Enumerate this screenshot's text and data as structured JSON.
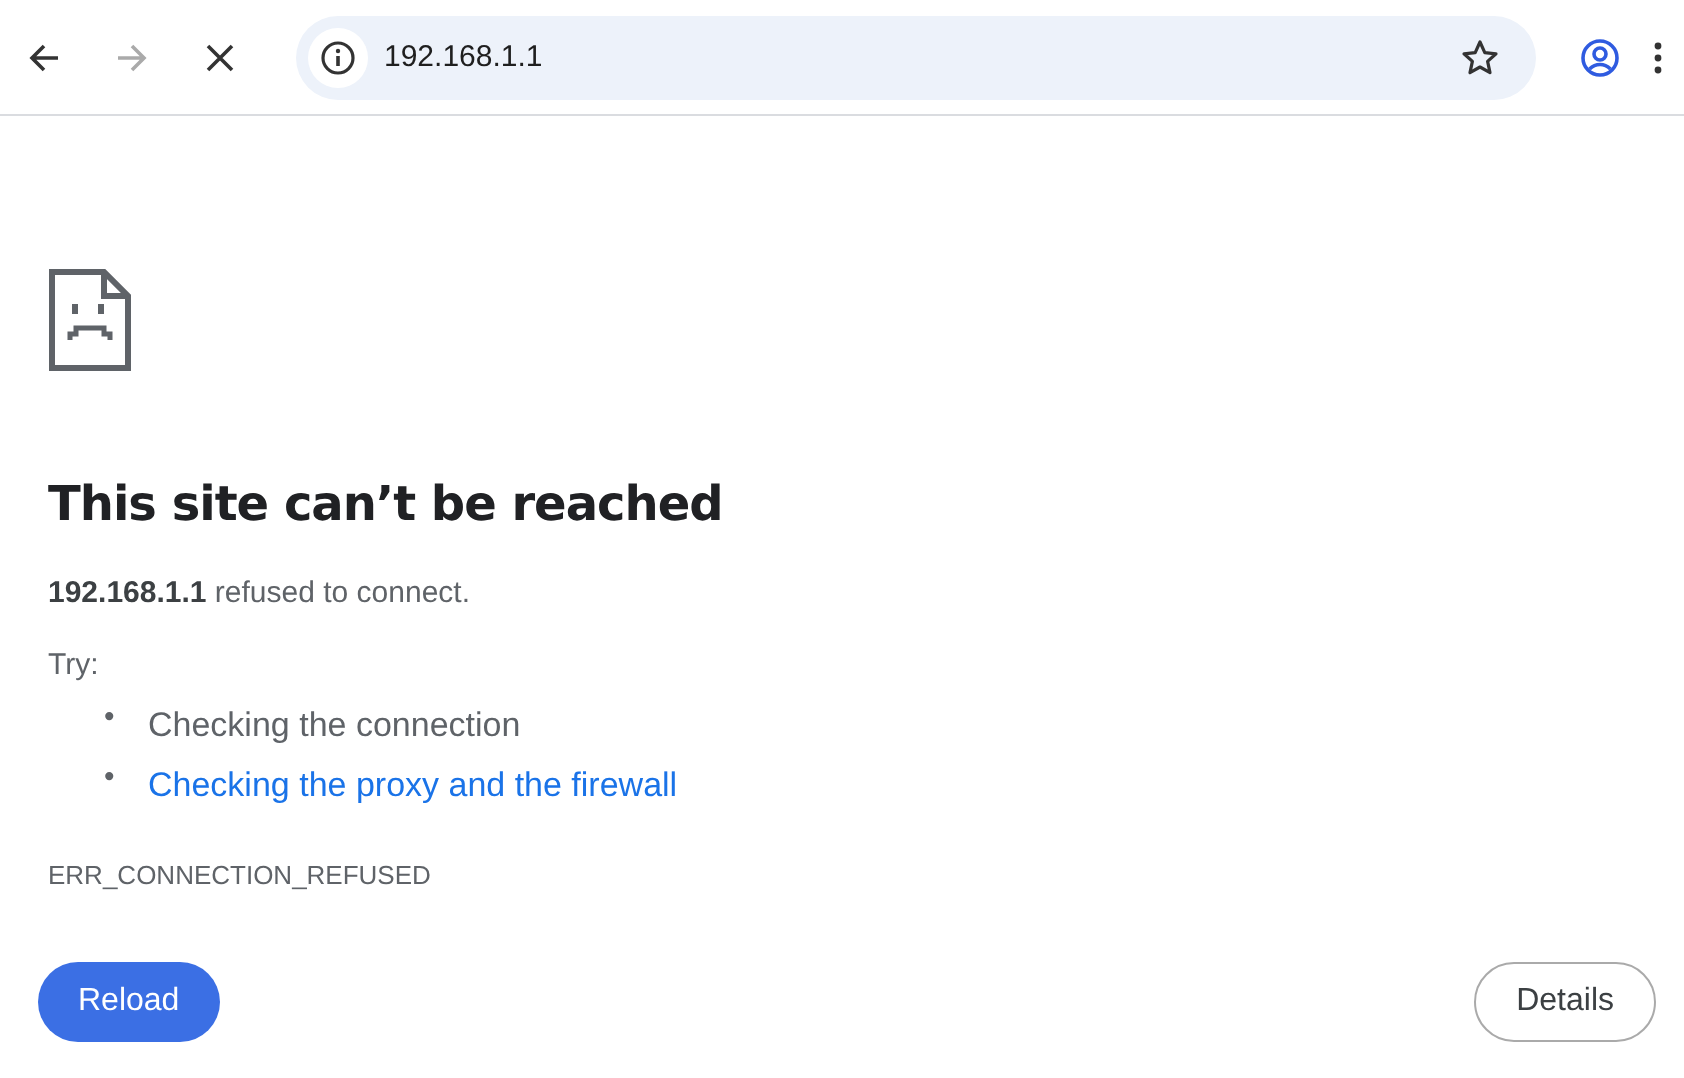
{
  "toolbar": {
    "nav_buttons": [
      {
        "kind": "back",
        "disabled": false
      },
      {
        "kind": "forward",
        "disabled": true
      },
      {
        "kind": "stop",
        "disabled": false
      }
    ],
    "address": "192.168.1.1"
  },
  "error": {
    "heading": "This site can’t be reached",
    "summary": "**192.168.1.1** refused to connect.",
    "try_label": "Try:",
    "suggestions": [
      {
        "kind": "text",
        "bullet": "•",
        "text": "Checking the connection"
      },
      {
        "kind": "link",
        "bullet": "•",
        "text": "Checking the proxy and the firewall"
      }
    ],
    "code": "ERR_CONNECTION_REFUSED",
    "buttons": [
      {
        "kind": "primary",
        "label": "Reload"
      },
      {
        "kind": "secondary",
        "label": "Details"
      }
    ]
  }
}
